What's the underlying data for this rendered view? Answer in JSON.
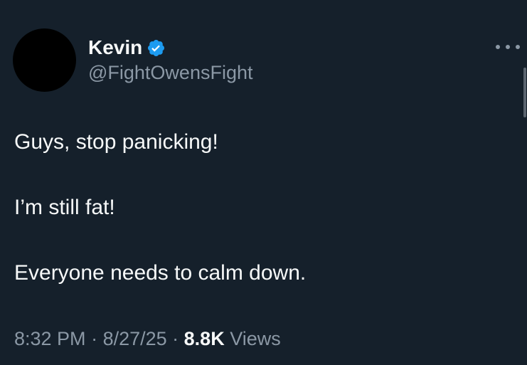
{
  "tweet": {
    "author": {
      "display_name": "Kevin",
      "handle": "@FightOwensFight",
      "verified": true,
      "verified_color": "#1d9bf0",
      "avatar_color": "#000000"
    },
    "more_icon": "more-horizontal-icon",
    "text_lines": [
      "Guys, stop panicking!",
      "I’m still fat!",
      "Everyone needs to calm down."
    ],
    "meta": {
      "time": "8:32 PM",
      "separator": " · ",
      "date": "8/27/25",
      "views_count": "8.8K",
      "views_label": "Views"
    }
  },
  "colors": {
    "background": "#15202b",
    "primary_text": "#f7f9f9",
    "secondary_text": "#8b98a5"
  }
}
